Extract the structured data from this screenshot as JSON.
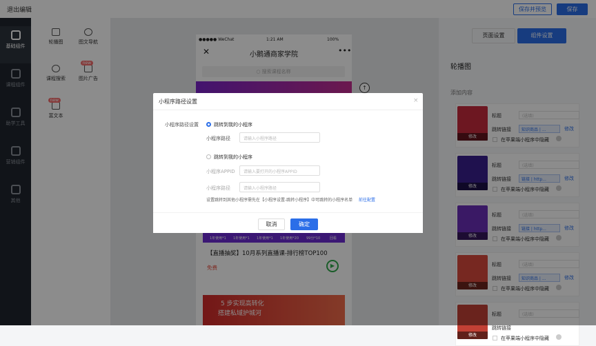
{
  "header": {
    "exit": "退出编辑",
    "save_preview": "保存并预览",
    "save": "保存"
  },
  "left_nav": [
    {
      "label": "基础组件",
      "active": true
    },
    {
      "label": "课程组件"
    },
    {
      "label": "助学工具"
    },
    {
      "label": "营销组件"
    },
    {
      "label": "其他"
    }
  ],
  "components": [
    {
      "label": "轮播图",
      "icon": "monitor-icon"
    },
    {
      "label": "图文导航",
      "icon": "bulb-icon"
    },
    {
      "label": "课程搜索",
      "icon": "search-icon"
    },
    {
      "label": "图片广告",
      "icon": "image-icon",
      "badge": "new"
    },
    {
      "label": "富文本",
      "icon": "text-icon",
      "badge": "new"
    }
  ],
  "phone": {
    "carrier": "●●●●● WeChat",
    "time": "1:21 AM",
    "battery": "100%",
    "title": "小鹅通商家学院",
    "search_placeholder": "搜索课程名称",
    "course_title": "【直播抽奖】10月系列直播课-排行榜TOP100",
    "price": "免费",
    "stripe": [
      "1年使用*1",
      "1年使用*1",
      "1年使用*1",
      "1年使用*20",
      "99分*10",
      "回看"
    ],
    "banner_line1": "5 步实现高转化",
    "banner_line2": "搭建私域护城河"
  },
  "right": {
    "tab_page": "页面设置",
    "tab_component": "组件设置",
    "section": "轮播图",
    "add_content": "添加内容",
    "title_label": "标题",
    "title_placeholder": "(选填)",
    "link_label": "跳转链接",
    "edit": "修改",
    "hide_ios": "在苹果端小程序中隐藏",
    "cards": [
      {
        "link": "知识商品 | ...",
        "color": "#c62b3c"
      },
      {
        "link": "链接 | http...",
        "color": "#3a1f8f"
      },
      {
        "link": "链接 | http...",
        "color": "#6a2fb8"
      },
      {
        "link": "知识商品 | ...",
        "color": "#d94a3d"
      },
      {
        "link": "",
        "color": "#c24035"
      }
    ],
    "thumb_edit": "修改"
  },
  "modal": {
    "title": "小程序路径设置",
    "row_label": "小程序路径设置",
    "opt1": "跳转到我的小程序",
    "path_label": "小程序路径",
    "path_ph": "请输入小程序路径",
    "opt2": "跳转到我的小程序",
    "appid_label": "小程序APPID",
    "appid_ph": "请输入要打开的小程序APPID",
    "path2_label": "小程序路径",
    "path2_ph": "请输入小程序路径",
    "hint": "设置跳转到其他小程序需先在【小程序设置-跳转小程序】中可跳转的小程序名单",
    "hint_link": "前往配置",
    "cancel": "取消",
    "ok": "确定",
    "close": "×"
  }
}
